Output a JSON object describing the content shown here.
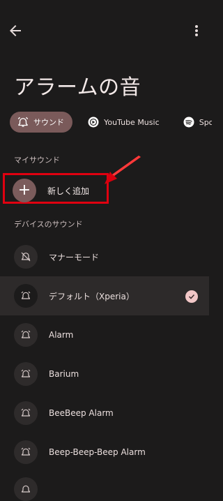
{
  "header": {
    "title": "アラームの音"
  },
  "chips": [
    {
      "label": "サウンド",
      "icon": "alarm-bell-icon",
      "active": true
    },
    {
      "label": "YouTube Music",
      "icon": "youtube-music-icon",
      "active": false
    },
    {
      "label": "Spotify",
      "icon": "spotify-icon",
      "active": false
    }
  ],
  "my_sounds": {
    "section_label": "マイサウンド",
    "add_new_label": "新しく追加"
  },
  "device_sounds": {
    "section_label": "デバイスのサウンド",
    "items": [
      {
        "label": "マナーモード",
        "icon": "bell-off-icon",
        "selected": false
      },
      {
        "label": "デフォルト（Xperia）",
        "icon": "alarm-bell-icon",
        "selected": true
      },
      {
        "label": "Alarm",
        "icon": "alarm-bell-icon",
        "selected": false
      },
      {
        "label": "Barium",
        "icon": "alarm-bell-icon",
        "selected": false
      },
      {
        "label": "BeeBeep Alarm",
        "icon": "alarm-bell-icon",
        "selected": false
      },
      {
        "label": "Beep-Beep-Beep Alarm",
        "icon": "alarm-bell-icon",
        "selected": false
      }
    ]
  },
  "colors": {
    "background": "#1c1b1b",
    "accent": "#7a5a5a",
    "highlight_frame": "#e00010",
    "check": "#f2c7c7"
  }
}
